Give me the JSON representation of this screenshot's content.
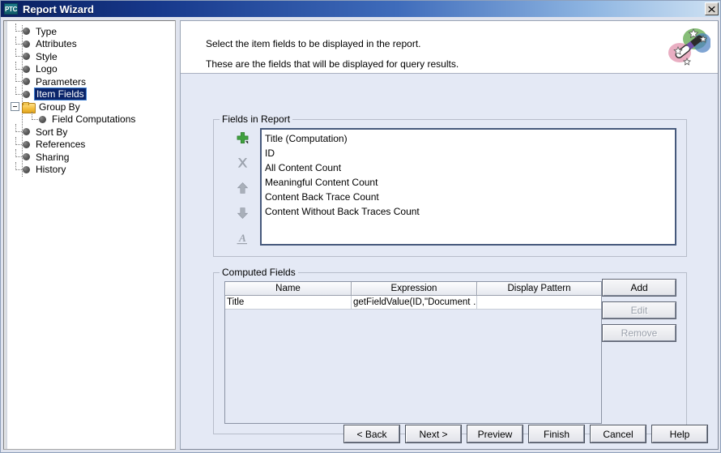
{
  "window": {
    "title": "Report Wizard",
    "logo_text": "PTC",
    "close_label": "✖"
  },
  "tree": {
    "nodes": [
      {
        "label": "Type",
        "icon": "bullet",
        "depth": 1,
        "selected": false,
        "expander": null
      },
      {
        "label": "Attributes",
        "icon": "bullet",
        "depth": 1,
        "selected": false,
        "expander": null
      },
      {
        "label": "Style",
        "icon": "bullet",
        "depth": 1,
        "selected": false,
        "expander": null
      },
      {
        "label": "Logo",
        "icon": "bullet",
        "depth": 1,
        "selected": false,
        "expander": null
      },
      {
        "label": "Parameters",
        "icon": "bullet",
        "depth": 1,
        "selected": false,
        "expander": null
      },
      {
        "label": "Item Fields",
        "icon": "bullet",
        "depth": 1,
        "selected": true,
        "expander": null
      },
      {
        "label": "Group By",
        "icon": "folder",
        "depth": 1,
        "selected": false,
        "expander": "minus"
      },
      {
        "label": "Field Computations",
        "icon": "bullet",
        "depth": 2,
        "selected": false,
        "expander": null
      },
      {
        "label": "Sort By",
        "icon": "bullet",
        "depth": 1,
        "selected": false,
        "expander": null
      },
      {
        "label": "References",
        "icon": "bullet",
        "depth": 1,
        "selected": false,
        "expander": null
      },
      {
        "label": "Sharing",
        "icon": "bullet",
        "depth": 1,
        "selected": false,
        "expander": null
      },
      {
        "label": "History",
        "icon": "bullet",
        "depth": 1,
        "selected": false,
        "expander": null
      }
    ]
  },
  "header": {
    "line1": "Select the item fields to be displayed in the report.",
    "line2": "These are the fields that will be displayed for query results.",
    "wand_icon": "magic-wand-icon"
  },
  "fields_in_report": {
    "title": "Fields in Report",
    "tools": [
      {
        "name": "add-field-icon",
        "glyph": "+"
      },
      {
        "name": "remove-field-icon",
        "glyph": "✖"
      },
      {
        "name": "move-up-icon",
        "glyph": "↑"
      },
      {
        "name": "move-down-icon",
        "glyph": "↓"
      },
      {
        "name": "rename-field-icon",
        "glyph": "A"
      }
    ],
    "items": [
      "Title (Computation)",
      "ID",
      "All Content Count",
      "Meaningful Content Count",
      "Content Back Trace Count",
      "Content Without Back Traces Count"
    ]
  },
  "computed_fields": {
    "title": "Computed Fields",
    "columns": [
      "Name",
      "Expression",
      "Display Pattern"
    ],
    "rows": [
      {
        "name": "Title",
        "expression": "getFieldValue(ID,\"Document …",
        "display_pattern": ""
      }
    ],
    "buttons": [
      {
        "label": "Add",
        "enabled": true
      },
      {
        "label": "Edit",
        "enabled": false
      },
      {
        "label": "Remove",
        "enabled": false
      }
    ]
  },
  "footer": {
    "buttons": [
      "< Back",
      "Next >",
      "Preview",
      "Finish",
      "Cancel",
      "Help"
    ]
  },
  "colors": {
    "title_start": "#0a2060",
    "title_end": "#cfe2f3",
    "panel_bg": "#e4e9f5",
    "selection": "#0a246a",
    "add_icon_green": "#3fa03f",
    "folder_gold": "#f3bf3e"
  }
}
